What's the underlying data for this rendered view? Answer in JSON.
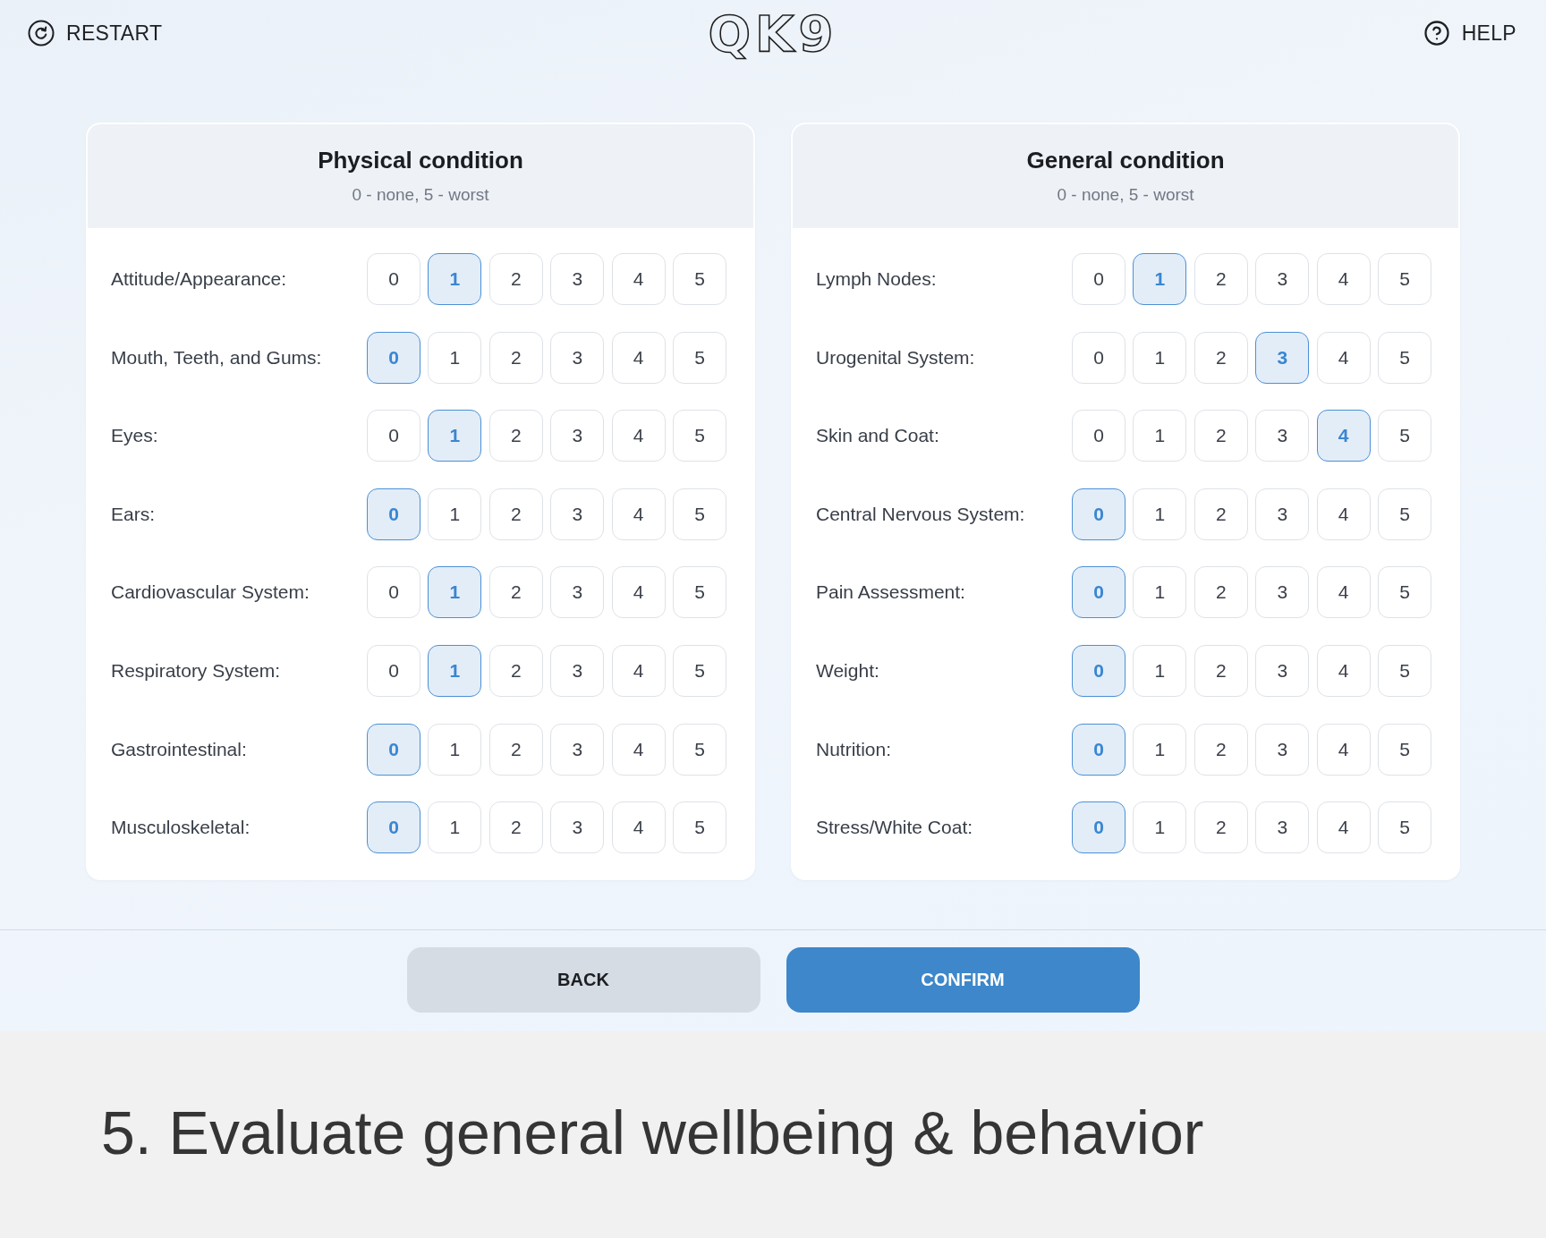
{
  "header": {
    "restart": "RESTART",
    "logo": "QK9",
    "help": "HELP"
  },
  "panels": [
    {
      "title": "Physical condition",
      "subtitle": "0 - none, 5 - worst",
      "rows": [
        {
          "label": "Attitude/Appearance:",
          "options": [
            {
              "label": "0",
              "selected": false
            },
            {
              "label": "1",
              "selected": true
            },
            {
              "label": "2",
              "selected": false
            },
            {
              "label": "3",
              "selected": false
            },
            {
              "label": "4",
              "selected": false
            },
            {
              "label": "5",
              "selected": false
            }
          ]
        },
        {
          "label": "Mouth, Teeth, and Gums:",
          "options": [
            {
              "label": "0",
              "selected": true
            },
            {
              "label": "1",
              "selected": false
            },
            {
              "label": "2",
              "selected": false
            },
            {
              "label": "3",
              "selected": false
            },
            {
              "label": "4",
              "selected": false
            },
            {
              "label": "5",
              "selected": false
            }
          ]
        },
        {
          "label": "Eyes:",
          "options": [
            {
              "label": "0",
              "selected": false
            },
            {
              "label": "1",
              "selected": true
            },
            {
              "label": "2",
              "selected": false
            },
            {
              "label": "3",
              "selected": false
            },
            {
              "label": "4",
              "selected": false
            },
            {
              "label": "5",
              "selected": false
            }
          ]
        },
        {
          "label": "Ears:",
          "options": [
            {
              "label": "0",
              "selected": true
            },
            {
              "label": "1",
              "selected": false
            },
            {
              "label": "2",
              "selected": false
            },
            {
              "label": "3",
              "selected": false
            },
            {
              "label": "4",
              "selected": false
            },
            {
              "label": "5",
              "selected": false
            }
          ]
        },
        {
          "label": "Cardiovascular System:",
          "options": [
            {
              "label": "0",
              "selected": false
            },
            {
              "label": "1",
              "selected": true
            },
            {
              "label": "2",
              "selected": false
            },
            {
              "label": "3",
              "selected": false
            },
            {
              "label": "4",
              "selected": false
            },
            {
              "label": "5",
              "selected": false
            }
          ]
        },
        {
          "label": "Respiratory System:",
          "options": [
            {
              "label": "0",
              "selected": false
            },
            {
              "label": "1",
              "selected": true
            },
            {
              "label": "2",
              "selected": false
            },
            {
              "label": "3",
              "selected": false
            },
            {
              "label": "4",
              "selected": false
            },
            {
              "label": "5",
              "selected": false
            }
          ]
        },
        {
          "label": "Gastrointestinal:",
          "options": [
            {
              "label": "0",
              "selected": true
            },
            {
              "label": "1",
              "selected": false
            },
            {
              "label": "2",
              "selected": false
            },
            {
              "label": "3",
              "selected": false
            },
            {
              "label": "4",
              "selected": false
            },
            {
              "label": "5",
              "selected": false
            }
          ]
        },
        {
          "label": "Musculoskeletal:",
          "options": [
            {
              "label": "0",
              "selected": true
            },
            {
              "label": "1",
              "selected": false
            },
            {
              "label": "2",
              "selected": false
            },
            {
              "label": "3",
              "selected": false
            },
            {
              "label": "4",
              "selected": false
            },
            {
              "label": "5",
              "selected": false
            }
          ]
        }
      ]
    },
    {
      "title": "General condition",
      "subtitle": "0 - none, 5 - worst",
      "rows": [
        {
          "label": "Lymph Nodes:",
          "options": [
            {
              "label": "0",
              "selected": false
            },
            {
              "label": "1",
              "selected": true
            },
            {
              "label": "2",
              "selected": false
            },
            {
              "label": "3",
              "selected": false
            },
            {
              "label": "4",
              "selected": false
            },
            {
              "label": "5",
              "selected": false
            }
          ]
        },
        {
          "label": "Urogenital System:",
          "options": [
            {
              "label": "0",
              "selected": false
            },
            {
              "label": "1",
              "selected": false
            },
            {
              "label": "2",
              "selected": false
            },
            {
              "label": "3",
              "selected": true
            },
            {
              "label": "4",
              "selected": false
            },
            {
              "label": "5",
              "selected": false
            }
          ]
        },
        {
          "label": "Skin and Coat:",
          "options": [
            {
              "label": "0",
              "selected": false
            },
            {
              "label": "1",
              "selected": false
            },
            {
              "label": "2",
              "selected": false
            },
            {
              "label": "3",
              "selected": false
            },
            {
              "label": "4",
              "selected": true
            },
            {
              "label": "5",
              "selected": false
            }
          ]
        },
        {
          "label": "Central Nervous System:",
          "options": [
            {
              "label": "0",
              "selected": true
            },
            {
              "label": "1",
              "selected": false
            },
            {
              "label": "2",
              "selected": false
            },
            {
              "label": "3",
              "selected": false
            },
            {
              "label": "4",
              "selected": false
            },
            {
              "label": "5",
              "selected": false
            }
          ]
        },
        {
          "label": "Pain Assessment:",
          "options": [
            {
              "label": "0",
              "selected": true
            },
            {
              "label": "1",
              "selected": false
            },
            {
              "label": "2",
              "selected": false
            },
            {
              "label": "3",
              "selected": false
            },
            {
              "label": "4",
              "selected": false
            },
            {
              "label": "5",
              "selected": false
            }
          ]
        },
        {
          "label": "Weight:",
          "options": [
            {
              "label": "0",
              "selected": true
            },
            {
              "label": "1",
              "selected": false
            },
            {
              "label": "2",
              "selected": false
            },
            {
              "label": "3",
              "selected": false
            },
            {
              "label": "4",
              "selected": false
            },
            {
              "label": "5",
              "selected": false
            }
          ]
        },
        {
          "label": "Nutrition:",
          "options": [
            {
              "label": "0",
              "selected": true
            },
            {
              "label": "1",
              "selected": false
            },
            {
              "label": "2",
              "selected": false
            },
            {
              "label": "3",
              "selected": false
            },
            {
              "label": "4",
              "selected": false
            },
            {
              "label": "5",
              "selected": false
            }
          ]
        },
        {
          "label": "Stress/White Coat:",
          "options": [
            {
              "label": "0",
              "selected": true
            },
            {
              "label": "1",
              "selected": false
            },
            {
              "label": "2",
              "selected": false
            },
            {
              "label": "3",
              "selected": false
            },
            {
              "label": "4",
              "selected": false
            },
            {
              "label": "5",
              "selected": false
            }
          ]
        }
      ]
    }
  ],
  "buttons": [
    {
      "label": "BACK",
      "kind": "secondary"
    },
    {
      "label": "CONFIRM",
      "kind": "primary"
    }
  ],
  "caption": "5. Evaluate general wellbeing & behavior"
}
